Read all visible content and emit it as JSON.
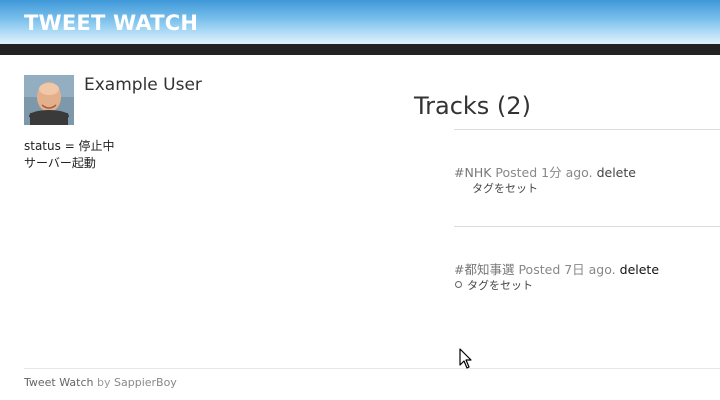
{
  "header": {
    "app_title": "TWEET WATCH"
  },
  "user": {
    "name": "Example User",
    "status_text": "status = 停止中",
    "server_text": "サーバー起動"
  },
  "tracks": {
    "title": "Tracks (2)",
    "items": [
      {
        "tag": "#NHK",
        "posted": "Posted 1分 ago.",
        "delete_label": "delete",
        "set_tag_label": "タグをセット"
      },
      {
        "tag": "#都知事選",
        "posted": "Posted 7日 ago.",
        "delete_label": "delete",
        "set_tag_label": "タグをセット"
      }
    ]
  },
  "footer": {
    "app_name": "Tweet Watch",
    "by": "by",
    "author": "SappierBoy"
  },
  "colors": {
    "header_gradient_top": "#3f98d8",
    "header_bar": "#222222",
    "text": "#222222"
  }
}
